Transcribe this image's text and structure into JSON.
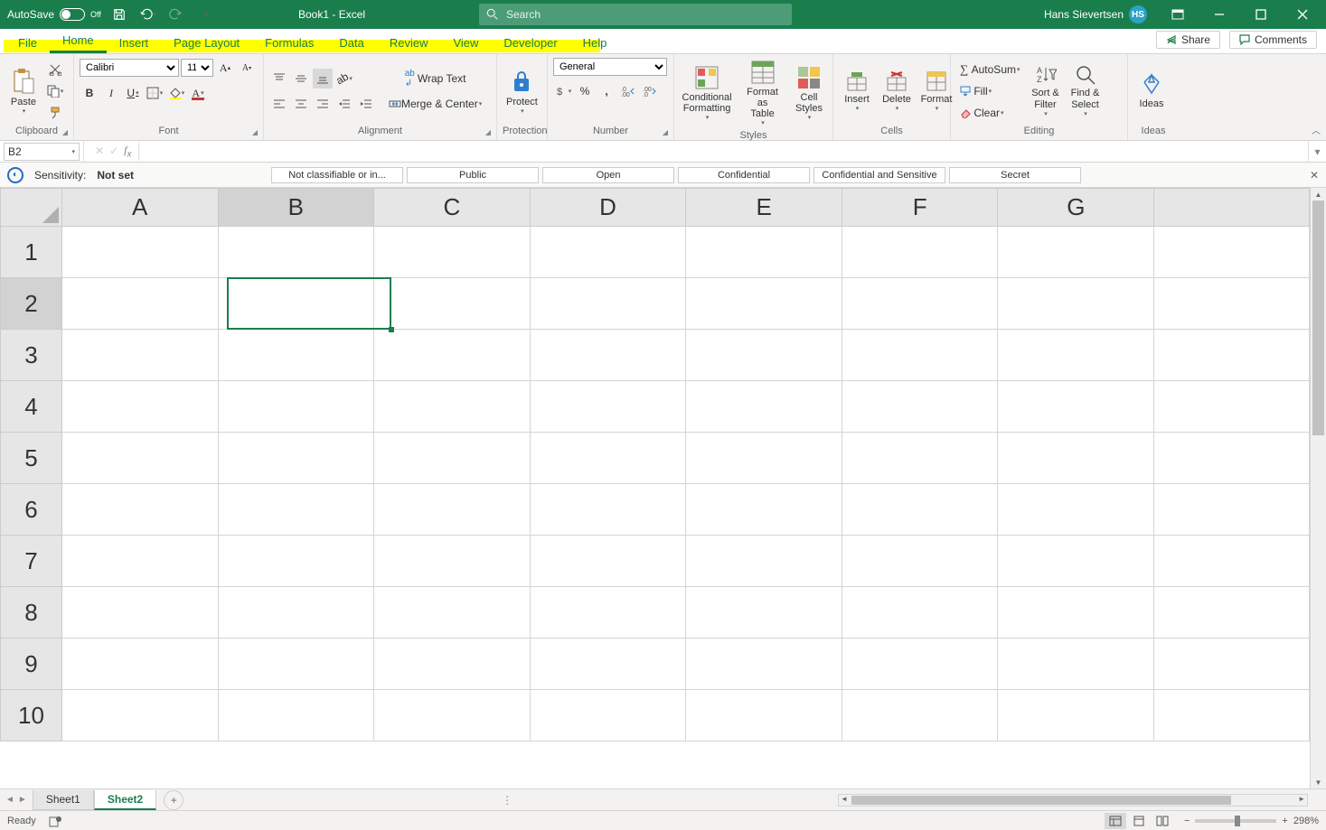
{
  "titlebar": {
    "autosave_label": "AutoSave",
    "autosave_state": "Off",
    "title": "Book1 - Excel",
    "search_placeholder": "Search",
    "user_name": "Hans Sievertsen",
    "user_initials": "HS"
  },
  "ribbon_tabs": [
    "File",
    "Home",
    "Insert",
    "Page Layout",
    "Formulas",
    "Data",
    "Review",
    "View",
    "Developer",
    "Help"
  ],
  "ribbon_active": "Home",
  "ribbon_right": {
    "share": "Share",
    "comments": "Comments"
  },
  "ribbon": {
    "clipboard": {
      "paste": "Paste",
      "group": "Clipboard"
    },
    "font": {
      "name": "Calibri",
      "size": "11",
      "group": "Font"
    },
    "alignment": {
      "wrap": "Wrap Text",
      "merge": "Merge & Center",
      "group": "Alignment"
    },
    "protection": {
      "protect": "Protect",
      "group": "Protection"
    },
    "number": {
      "format": "General",
      "group": "Number"
    },
    "styles": {
      "cond": "Conditional Formatting",
      "table": "Format as Table",
      "cell": "Cell Styles",
      "group": "Styles"
    },
    "cells": {
      "insert": "Insert",
      "delete": "Delete",
      "format": "Format",
      "group": "Cells"
    },
    "editing": {
      "autosum": "AutoSum",
      "fill": "Fill",
      "clear": "Clear",
      "sort": "Sort & Filter",
      "find": "Find & Select",
      "group": "Editing"
    },
    "ideas": {
      "ideas": "Ideas",
      "group": "Ideas"
    }
  },
  "namebox": "B2",
  "sensitivity": {
    "label": "Sensitivity:",
    "value": "Not set",
    "options": [
      "Not classifiable or in...",
      "Public",
      "Open",
      "Confidential",
      "Confidential and Sensitive",
      "Secret"
    ]
  },
  "grid": {
    "columns": [
      "A",
      "B",
      "C",
      "D",
      "E",
      "F",
      "G"
    ],
    "rows": [
      "1",
      "2",
      "3",
      "4",
      "5",
      "6",
      "7",
      "8",
      "9",
      "10"
    ],
    "selected": {
      "col": 1,
      "row": 1
    }
  },
  "sheets": {
    "tabs": [
      "Sheet1",
      "Sheet2"
    ],
    "active": "Sheet2"
  },
  "status": {
    "ready": "Ready",
    "zoom": "298%"
  }
}
